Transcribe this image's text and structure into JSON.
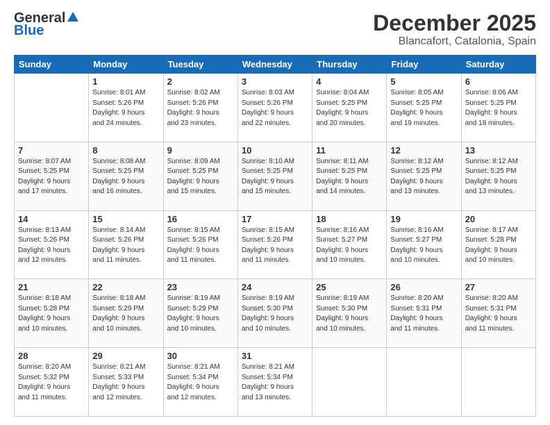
{
  "logo": {
    "general": "General",
    "blue": "Blue"
  },
  "header": {
    "month": "December 2025",
    "location": "Blancafort, Catalonia, Spain"
  },
  "weekdays": [
    "Sunday",
    "Monday",
    "Tuesday",
    "Wednesday",
    "Thursday",
    "Friday",
    "Saturday"
  ],
  "weeks": [
    [
      {
        "day": "",
        "info": ""
      },
      {
        "day": "1",
        "info": "Sunrise: 8:01 AM\nSunset: 5:26 PM\nDaylight: 9 hours\nand 24 minutes."
      },
      {
        "day": "2",
        "info": "Sunrise: 8:02 AM\nSunset: 5:26 PM\nDaylight: 9 hours\nand 23 minutes."
      },
      {
        "day": "3",
        "info": "Sunrise: 8:03 AM\nSunset: 5:26 PM\nDaylight: 9 hours\nand 22 minutes."
      },
      {
        "day": "4",
        "info": "Sunrise: 8:04 AM\nSunset: 5:25 PM\nDaylight: 9 hours\nand 20 minutes."
      },
      {
        "day": "5",
        "info": "Sunrise: 8:05 AM\nSunset: 5:25 PM\nDaylight: 9 hours\nand 19 minutes."
      },
      {
        "day": "6",
        "info": "Sunrise: 8:06 AM\nSunset: 5:25 PM\nDaylight: 9 hours\nand 18 minutes."
      }
    ],
    [
      {
        "day": "7",
        "info": "Sunrise: 8:07 AM\nSunset: 5:25 PM\nDaylight: 9 hours\nand 17 minutes."
      },
      {
        "day": "8",
        "info": "Sunrise: 8:08 AM\nSunset: 5:25 PM\nDaylight: 9 hours\nand 16 minutes."
      },
      {
        "day": "9",
        "info": "Sunrise: 8:09 AM\nSunset: 5:25 PM\nDaylight: 9 hours\nand 15 minutes."
      },
      {
        "day": "10",
        "info": "Sunrise: 8:10 AM\nSunset: 5:25 PM\nDaylight: 9 hours\nand 15 minutes."
      },
      {
        "day": "11",
        "info": "Sunrise: 8:11 AM\nSunset: 5:25 PM\nDaylight: 9 hours\nand 14 minutes."
      },
      {
        "day": "12",
        "info": "Sunrise: 8:12 AM\nSunset: 5:25 PM\nDaylight: 9 hours\nand 13 minutes."
      },
      {
        "day": "13",
        "info": "Sunrise: 8:12 AM\nSunset: 5:25 PM\nDaylight: 9 hours\nand 13 minutes."
      }
    ],
    [
      {
        "day": "14",
        "info": "Sunrise: 8:13 AM\nSunset: 5:26 PM\nDaylight: 9 hours\nand 12 minutes."
      },
      {
        "day": "15",
        "info": "Sunrise: 8:14 AM\nSunset: 5:26 PM\nDaylight: 9 hours\nand 11 minutes."
      },
      {
        "day": "16",
        "info": "Sunrise: 8:15 AM\nSunset: 5:26 PM\nDaylight: 9 hours\nand 11 minutes."
      },
      {
        "day": "17",
        "info": "Sunrise: 8:15 AM\nSunset: 5:26 PM\nDaylight: 9 hours\nand 11 minutes."
      },
      {
        "day": "18",
        "info": "Sunrise: 8:16 AM\nSunset: 5:27 PM\nDaylight: 9 hours\nand 10 minutes."
      },
      {
        "day": "19",
        "info": "Sunrise: 8:16 AM\nSunset: 5:27 PM\nDaylight: 9 hours\nand 10 minutes."
      },
      {
        "day": "20",
        "info": "Sunrise: 8:17 AM\nSunset: 5:28 PM\nDaylight: 9 hours\nand 10 minutes."
      }
    ],
    [
      {
        "day": "21",
        "info": "Sunrise: 8:18 AM\nSunset: 5:28 PM\nDaylight: 9 hours\nand 10 minutes."
      },
      {
        "day": "22",
        "info": "Sunrise: 8:18 AM\nSunset: 5:29 PM\nDaylight: 9 hours\nand 10 minutes."
      },
      {
        "day": "23",
        "info": "Sunrise: 8:19 AM\nSunset: 5:29 PM\nDaylight: 9 hours\nand 10 minutes."
      },
      {
        "day": "24",
        "info": "Sunrise: 8:19 AM\nSunset: 5:30 PM\nDaylight: 9 hours\nand 10 minutes."
      },
      {
        "day": "25",
        "info": "Sunrise: 8:19 AM\nSunset: 5:30 PM\nDaylight: 9 hours\nand 10 minutes."
      },
      {
        "day": "26",
        "info": "Sunrise: 8:20 AM\nSunset: 5:31 PM\nDaylight: 9 hours\nand 11 minutes."
      },
      {
        "day": "27",
        "info": "Sunrise: 8:20 AM\nSunset: 5:31 PM\nDaylight: 9 hours\nand 11 minutes."
      }
    ],
    [
      {
        "day": "28",
        "info": "Sunrise: 8:20 AM\nSunset: 5:32 PM\nDaylight: 9 hours\nand 11 minutes."
      },
      {
        "day": "29",
        "info": "Sunrise: 8:21 AM\nSunset: 5:33 PM\nDaylight: 9 hours\nand 12 minutes."
      },
      {
        "day": "30",
        "info": "Sunrise: 8:21 AM\nSunset: 5:34 PM\nDaylight: 9 hours\nand 12 minutes."
      },
      {
        "day": "31",
        "info": "Sunrise: 8:21 AM\nSunset: 5:34 PM\nDaylight: 9 hours\nand 13 minutes."
      },
      {
        "day": "",
        "info": ""
      },
      {
        "day": "",
        "info": ""
      },
      {
        "day": "",
        "info": ""
      }
    ]
  ]
}
